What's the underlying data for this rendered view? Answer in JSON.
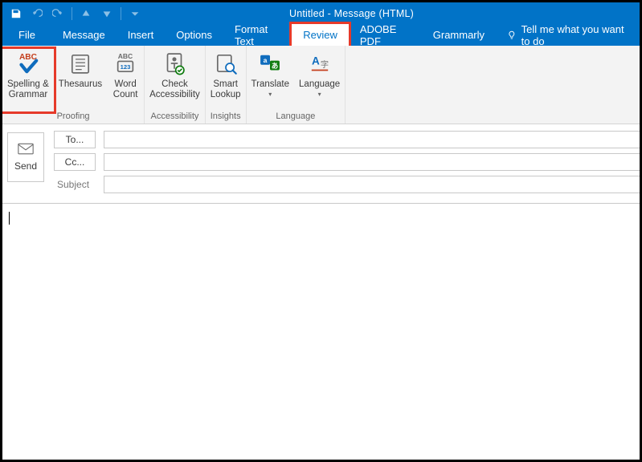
{
  "window": {
    "title": "Untitled  -  Message (HTML)"
  },
  "qat": {
    "save": "save-icon",
    "undo": "undo-icon",
    "redo": "redo-icon",
    "prev": "prev-icon",
    "next": "next-icon",
    "down": "down-icon",
    "customize": "customize-icon"
  },
  "menu": {
    "tabs": [
      {
        "label": "File"
      },
      {
        "label": "Message"
      },
      {
        "label": "Insert"
      },
      {
        "label": "Options"
      },
      {
        "label": "Format Text"
      },
      {
        "label": "Review",
        "active": true,
        "highlighted": true
      },
      {
        "label": "ADOBE PDF"
      },
      {
        "label": "Grammarly"
      }
    ],
    "tellme": "Tell me what you want to do"
  },
  "ribbon": {
    "groups": [
      {
        "name": "Proofing",
        "buttons": [
          {
            "line1": "Spelling &",
            "line2": "Grammar",
            "icon": "spelling",
            "highlighted": true
          },
          {
            "line1": "Thesaurus",
            "line2": "",
            "icon": "thesaurus"
          },
          {
            "line1": "Word",
            "line2": "Count",
            "icon": "wordcount"
          }
        ]
      },
      {
        "name": "Accessibility",
        "buttons": [
          {
            "line1": "Check",
            "line2": "Accessibility",
            "icon": "accessibility"
          }
        ]
      },
      {
        "name": "Insights",
        "buttons": [
          {
            "line1": "Smart",
            "line2": "Lookup",
            "icon": "lookup"
          }
        ]
      },
      {
        "name": "Language",
        "buttons": [
          {
            "line1": "Translate",
            "line2": "",
            "icon": "translate",
            "dropdown": true
          },
          {
            "line1": "Language",
            "line2": "",
            "icon": "language",
            "dropdown": true
          }
        ]
      }
    ]
  },
  "compose": {
    "send": "Send",
    "to_label": "To...",
    "cc_label": "Cc...",
    "subject_label": "Subject",
    "to_value": "",
    "cc_value": "",
    "subject_value": ""
  },
  "body": {
    "text": ""
  }
}
